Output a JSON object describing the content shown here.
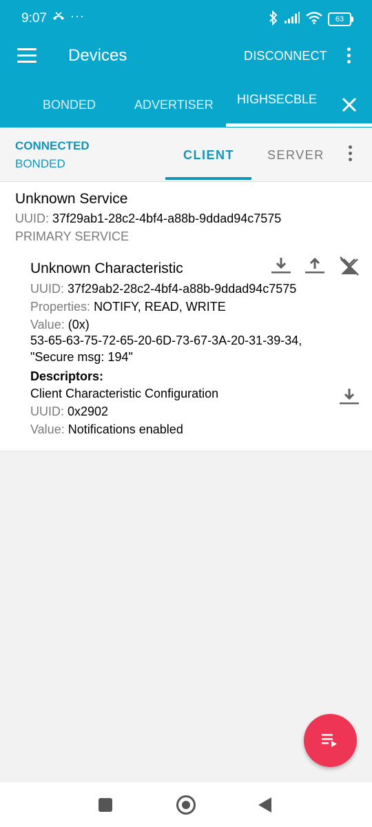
{
  "status_bar": {
    "time": "9:07",
    "call_icon": "missed-call-icon",
    "overflow": "···",
    "battery": "63"
  },
  "app_bar": {
    "title": "Devices",
    "disconnect_label": "DISCONNECT"
  },
  "device_tabs": [
    {
      "label": "BONDED"
    },
    {
      "label": "ADVERTISER"
    },
    {
      "label": "HIGHSECBLE",
      "active": true
    }
  ],
  "connection": {
    "state": "CONNECTED",
    "bond": "BONDED"
  },
  "role_tabs": {
    "client": "CLIENT",
    "server": "SERVER",
    "active": "CLIENT"
  },
  "service": {
    "name": "Unknown Service",
    "uuid_label": "UUID:",
    "uuid": "37f29ab1-28c2-4bf4-a88b-9ddad94c7575",
    "type": "PRIMARY SERVICE"
  },
  "characteristic": {
    "name": "Unknown Characteristic",
    "uuid_label": "UUID:",
    "uuid": "37f29ab2-28c2-4bf4-a88b-9ddad94c7575",
    "properties_label": "Properties:",
    "properties": "NOTIFY, READ, WRITE",
    "value_label": "Value:",
    "value_prefix": "(0x)",
    "value_hex": "53-65-63-75-72-65-20-6D-73-67-3A-20-31-39-34,",
    "value_text": "\"Secure msg: 194\""
  },
  "descriptors": {
    "heading": "Descriptors:",
    "items": [
      {
        "name": "Client Characteristic Configuration",
        "uuid_label": "UUID:",
        "uuid": "0x2902",
        "value_label": "Value:",
        "value": "Notifications enabled"
      }
    ]
  },
  "colors": {
    "primary": "#0aa7cc",
    "accent_text": "#1395b8",
    "fab": "#ef3556"
  }
}
